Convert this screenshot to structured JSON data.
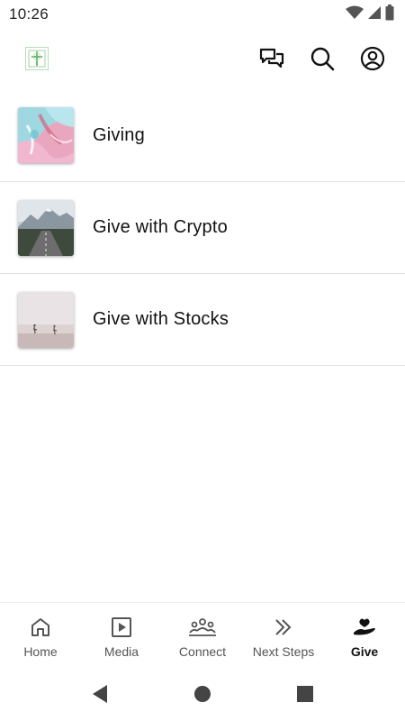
{
  "status_bar": {
    "time": "10:26"
  },
  "app_bar": {
    "logo_icon": "cross-logo-icon",
    "actions": [
      {
        "name": "messages-icon"
      },
      {
        "name": "search-icon"
      },
      {
        "name": "account-icon"
      }
    ]
  },
  "list": {
    "items": [
      {
        "label": "Giving",
        "thumbnail": "abstract-pink-teal-art"
      },
      {
        "label": "Give with Crypto",
        "thumbnail": "mountain-road-photo"
      },
      {
        "label": "Give with Stocks",
        "thumbnail": "misty-beach-people-photo"
      }
    ]
  },
  "bottom_nav": {
    "items": [
      {
        "label": "Home",
        "icon": "home-icon",
        "active": false
      },
      {
        "label": "Media",
        "icon": "play-icon",
        "active": false
      },
      {
        "label": "Connect",
        "icon": "group-icon",
        "active": false
      },
      {
        "label": "Next Steps",
        "icon": "double-chevron-icon",
        "active": false
      },
      {
        "label": "Give",
        "icon": "hand-heart-icon",
        "active": true
      }
    ]
  },
  "colors": {
    "text_primary": "#111111",
    "text_secondary": "#555555",
    "divider": "#e2e2e2",
    "logo_green": "#8fc98f"
  }
}
